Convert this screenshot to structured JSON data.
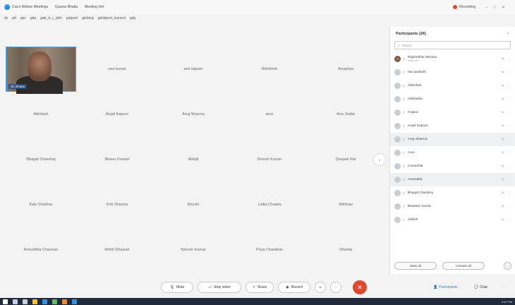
{
  "titlebar": {
    "app_title": "Cisco Webex Meetings",
    "menu_item_2": "Gaurav Bhatia",
    "menu_item_3": "Meeting Info",
    "recording_label": "Recording"
  },
  "topics_line": [
    "ds",
    "ptt",
    "ppc",
    "gda",
    "gda_tr_r_vldn",
    "pptpool",
    "gtobing",
    "gdxbpool_tssnrcd",
    "gdg"
  ],
  "grid": {
    "tiles": [
      {
        "label": "",
        "video": true,
        "name_tag": "Gr. Bhatia"
      },
      {
        "label": "ravi kumar"
      },
      {
        "label": "anil sajwan"
      },
      {
        "label": "Abhishek"
      },
      {
        "label": "Anupriya"
      },
      {
        "label": "Abhilash"
      },
      {
        "label": "Anjali Kapoor"
      },
      {
        "label": "Anuj Sharma"
      },
      {
        "label": "arun"
      },
      {
        "label": "Anu Jindal"
      },
      {
        "label": "Bhagat Chandraj"
      },
      {
        "label": "Bhanu Kumari"
      },
      {
        "label": "Abhijit"
      },
      {
        "label": "Dinesh Kumar"
      },
      {
        "label": "Deepak Rai"
      },
      {
        "label": "Kalu Shekhar"
      },
      {
        "label": "Kriti Sharma"
      },
      {
        "label": "Khushi"
      },
      {
        "label": "Lalita Chawla"
      },
      {
        "label": "Abhinav"
      },
      {
        "label": "Aniruddha Chauhan"
      },
      {
        "label": "Mohit Dhawan"
      },
      {
        "label": "Naresh Kumar"
      },
      {
        "label": "Priya Chandran"
      },
      {
        "label": "Shweta"
      }
    ]
  },
  "panel": {
    "title": "Participants (26)",
    "close": "×",
    "search_placeholder": "Search",
    "participants": [
      {
        "name": "Rajshekhar Behara",
        "sub": "Host, me",
        "hl": false,
        "avatar_img": true
      },
      {
        "name": "ravi prakash",
        "hl": false
      },
      {
        "name": "Abhishek",
        "hl": false
      },
      {
        "name": "Abhilasha",
        "hl": false
      },
      {
        "name": "Anjana",
        "hl": false
      },
      {
        "name": "Anjali Kapoor",
        "hl": false
      },
      {
        "name": "Anuj Sharma",
        "hl": true
      },
      {
        "name": "Arun",
        "hl": false
      },
      {
        "name": "Arunachal",
        "hl": false
      },
      {
        "name": "Anuradha",
        "hl": true
      },
      {
        "name": "Bhagat Chandraj",
        "hl": false
      },
      {
        "name": "Bhaskar Anand",
        "hl": false
      },
      {
        "name": "Abhish",
        "hl": false
      }
    ],
    "mute_all": "Mute all",
    "unmute_all": "Unmute all",
    "more": "···"
  },
  "toolbar": {
    "mute": "Mute",
    "stop_video": "Stop video",
    "share": "Share",
    "record": "Record",
    "end": "✕",
    "participants": "Participants",
    "chat": "Chat"
  },
  "taskbar": {
    "clock": "5:41 PM"
  },
  "colors": {
    "end_red": "#e0482e",
    "accent_blue": "#4aa3e8"
  }
}
